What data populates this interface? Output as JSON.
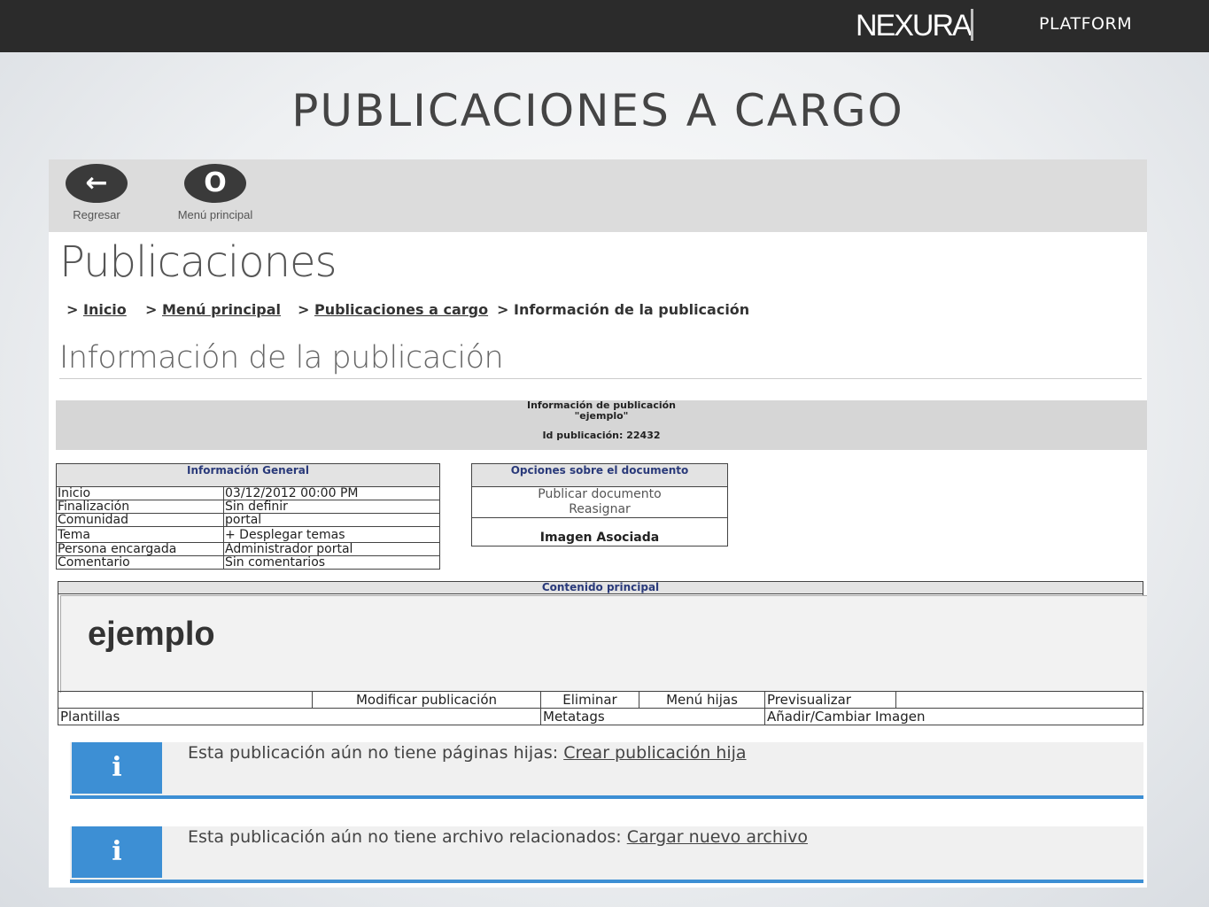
{
  "header": {
    "brand": "NEXURA",
    "product": "PLATFORM"
  },
  "slide_title": "PUBLICACIONES A CARGO",
  "toolbar": {
    "back_label": "Regresar",
    "back_icon": "←",
    "menu_label": "Menú principal",
    "menu_icon": "O"
  },
  "page_title": "Publicaciones",
  "breadcrumb": [
    {
      "label": "Inicio"
    },
    {
      "label": "Menú principal"
    },
    {
      "label": "Publicaciones a cargo"
    },
    {
      "label": "Información de la publicación"
    }
  ],
  "section_title": "Información de la publicación",
  "info_bar": {
    "line1": "Información de publicación",
    "line2": "\"ejemplo\"",
    "line3": "Id publicación: 22432"
  },
  "general_info": {
    "header": "Información General",
    "rows": [
      {
        "label": "Inicio",
        "value": "03/12/2012 00:00 PM"
      },
      {
        "label": "Finalización",
        "value": "Sin definir"
      },
      {
        "label": "Comunidad",
        "value": "portal"
      },
      {
        "label": "Tema",
        "value": "+ Desplegar temas"
      },
      {
        "label": "Persona encargada",
        "value": "Administrador portal"
      },
      {
        "label": "Comentario",
        "value": "Sin comentarios"
      }
    ]
  },
  "doc_options": {
    "header": "Opciones sobre el documento",
    "publish": "Publicar documento",
    "reassign": "Reasignar",
    "image": "Imagen Asociada"
  },
  "content": {
    "header": "Contenido principal",
    "title": "ejemplo"
  },
  "actions": {
    "modify": "Modificar publicación",
    "delete": "Eliminar",
    "child_menu": "Menú hijas",
    "preview": "Previsualizar",
    "templates": "Plantillas",
    "metatags": "Metatags",
    "image": "Añadir/Cambiar Imagen"
  },
  "notices": [
    {
      "text": "Esta publicación aún no tiene páginas hijas: ",
      "link": "Crear publicación hija",
      "icon": "i"
    },
    {
      "text": "Esta publicación aún no tiene archivo relacionados: ",
      "link": "Cargar nuevo archivo",
      "icon": "i"
    }
  ]
}
